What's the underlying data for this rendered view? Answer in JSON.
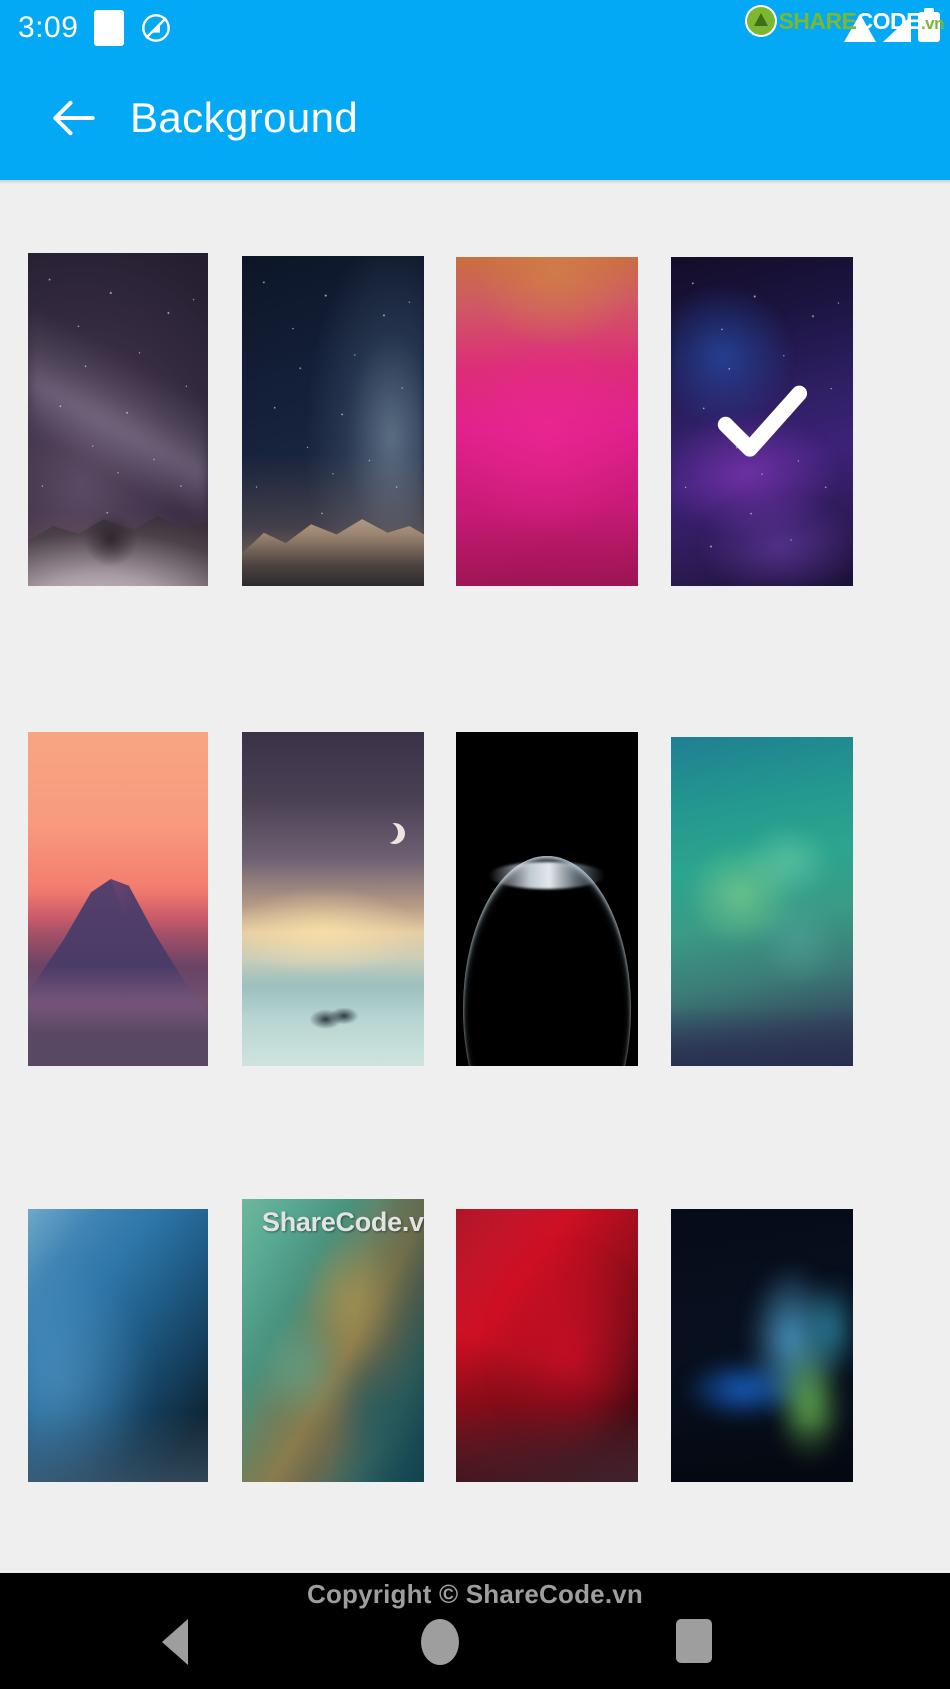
{
  "status_bar": {
    "clock": "3:09",
    "icons": [
      "screenshot-icon",
      "data-saver-icon"
    ],
    "system_icons": [
      "wifi-icon",
      "signal-icon",
      "battery-icon"
    ],
    "watermark": {
      "share": "SHARE",
      "code": "CODE",
      "tld": ".vn"
    },
    "background_color": "#03A9F4"
  },
  "app_bar": {
    "back_label": "back-arrow",
    "title": "Background",
    "background_color": "#03A9F4",
    "text_color": "#FFFFFF"
  },
  "grid": {
    "columns": 4,
    "rows": 3,
    "selected_index": 3,
    "tile_watermark": "ShareCode.vn",
    "items": [
      {
        "id": 1,
        "name": "milky-way-purple-mountain",
        "alt": "Purple starry sky over snowy mountain ridge"
      },
      {
        "id": 2,
        "name": "milky-way-blue-mountain",
        "alt": "Blue starry sky with glowing Milky Way over snowy peak"
      },
      {
        "id": 3,
        "name": "pink-magenta-gradient",
        "alt": "Orange to magenta gradient"
      },
      {
        "id": 4,
        "name": "purple-galaxy-nebula",
        "alt": "Purple nebula galaxy",
        "selected": true
      },
      {
        "id": 5,
        "name": "mount-fuji-sunset",
        "alt": "Mount Fuji at orange sunset"
      },
      {
        "id": 6,
        "name": "crescent-moon-seascape",
        "alt": "Crescent moon over pastel sea"
      },
      {
        "id": 7,
        "name": "earth-crescent-black",
        "alt": "Earth crescent on black space"
      },
      {
        "id": 8,
        "name": "teal-aurora-blur",
        "alt": "Teal and green aurora blur"
      },
      {
        "id": 9,
        "name": "blue-steel-gradient",
        "alt": "Blue to dark navy diagonal gradient"
      },
      {
        "id": 10,
        "name": "green-olive-blur",
        "alt": "Green and olive blurred gradient",
        "has_watermark": true
      },
      {
        "id": 11,
        "name": "red-crimson-gradient",
        "alt": "Crimson red diagonal gradient"
      },
      {
        "id": 12,
        "name": "blue-green-abstract",
        "alt": "Blue and green glowing abstract on dark"
      }
    ]
  },
  "nav_bar": {
    "copyright": "Copyright © ShareCode.vn",
    "buttons": [
      {
        "name": "back-button",
        "glyph": "triangle-left"
      },
      {
        "name": "home-button",
        "glyph": "circle"
      },
      {
        "name": "recents-button",
        "glyph": "square"
      }
    ],
    "background_color": "#000000",
    "icon_color": "#9E9E9E"
  }
}
